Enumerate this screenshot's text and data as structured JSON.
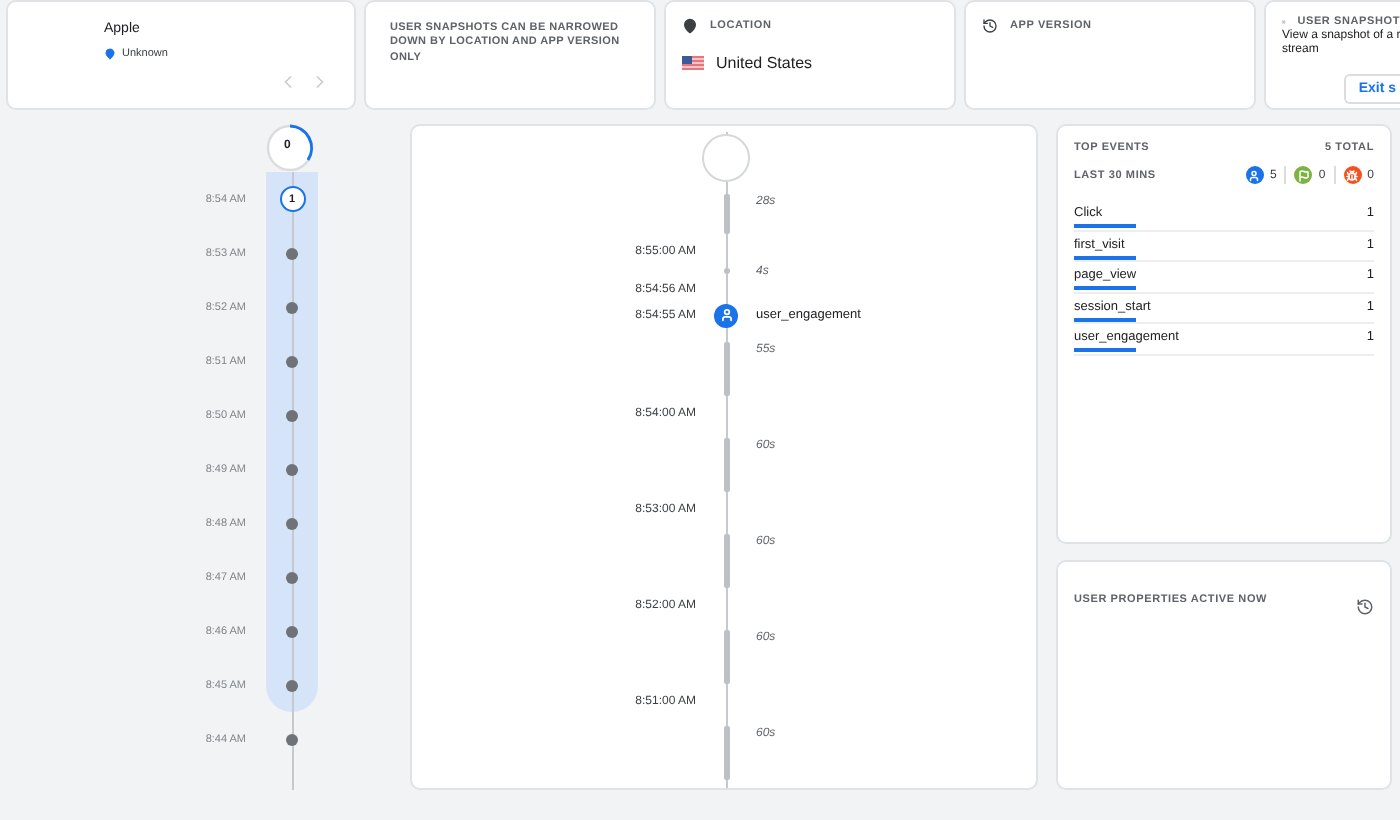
{
  "device": {
    "name": "Apple",
    "location": "Unknown",
    "prev_disabled": true,
    "next_disabled": true
  },
  "notice": "USER SNAPSHOTS CAN BE NARROWED DOWN BY LOCATION AND APP VERSION ONLY",
  "location": {
    "title": "LOCATION",
    "country": "United States"
  },
  "app_version": {
    "title": "APP VERSION"
  },
  "snapshot": {
    "title": "USER SNAPSHOT",
    "text_line_1": "View a snapshot of a r",
    "text_line_2": "stream",
    "button": "Exit s"
  },
  "minute_timeline": {
    "top_count": "0",
    "minutes": [
      {
        "time": "8:54 AM",
        "count": "1",
        "selected": true,
        "highlighted": true
      },
      {
        "time": "8:53 AM",
        "selected": false,
        "highlighted": true
      },
      {
        "time": "8:52 AM",
        "selected": false,
        "highlighted": true
      },
      {
        "time": "8:51 AM",
        "selected": false,
        "highlighted": true
      },
      {
        "time": "8:50 AM",
        "selected": false,
        "highlighted": true
      },
      {
        "time": "8:49 AM",
        "selected": false,
        "highlighted": true
      },
      {
        "time": "8:48 AM",
        "selected": false,
        "highlighted": true
      },
      {
        "time": "8:47 AM",
        "selected": false,
        "highlighted": true
      },
      {
        "time": "8:46 AM",
        "selected": false,
        "highlighted": true
      },
      {
        "time": "8:45 AM",
        "selected": false,
        "highlighted": true
      },
      {
        "time": "8:44 AM",
        "selected": false,
        "highlighted": false
      }
    ]
  },
  "event_stream": [
    {
      "kind": "gap",
      "label": "28s"
    },
    {
      "kind": "time",
      "label": "8:55:00 AM"
    },
    {
      "kind": "tick",
      "label": "4s"
    },
    {
      "kind": "time",
      "label": "8:54:56 AM"
    },
    {
      "kind": "event",
      "time": "8:54:55 AM",
      "label": "user_engagement"
    },
    {
      "kind": "gap",
      "label": "55s"
    },
    {
      "kind": "time",
      "label": "8:54:00 AM"
    },
    {
      "kind": "gap",
      "label": "60s"
    },
    {
      "kind": "time",
      "label": "8:53:00 AM"
    },
    {
      "kind": "gap",
      "label": "60s"
    },
    {
      "kind": "time",
      "label": "8:52:00 AM"
    },
    {
      "kind": "gap",
      "label": "60s"
    },
    {
      "kind": "time",
      "label": "8:51:00 AM"
    },
    {
      "kind": "gap",
      "label": "60s"
    }
  ],
  "top_events": {
    "title": "TOP EVENTS",
    "total": "5 TOTAL",
    "period": "LAST 30 MINS",
    "counters": [
      {
        "kind": "user",
        "value": "5",
        "color": "#1a73e8"
      },
      {
        "kind": "flag",
        "value": "0",
        "color": "#7cb342"
      },
      {
        "kind": "alert",
        "value": "0",
        "color": "#f4511e"
      }
    ],
    "events": [
      {
        "name": "Click",
        "count": "1"
      },
      {
        "name": "first_visit",
        "count": "1"
      },
      {
        "name": "page_view",
        "count": "1"
      },
      {
        "name": "session_start",
        "count": "1"
      },
      {
        "name": "user_engagement",
        "count": "1"
      }
    ]
  },
  "user_properties": {
    "title": "USER PROPERTIES ACTIVE NOW"
  }
}
